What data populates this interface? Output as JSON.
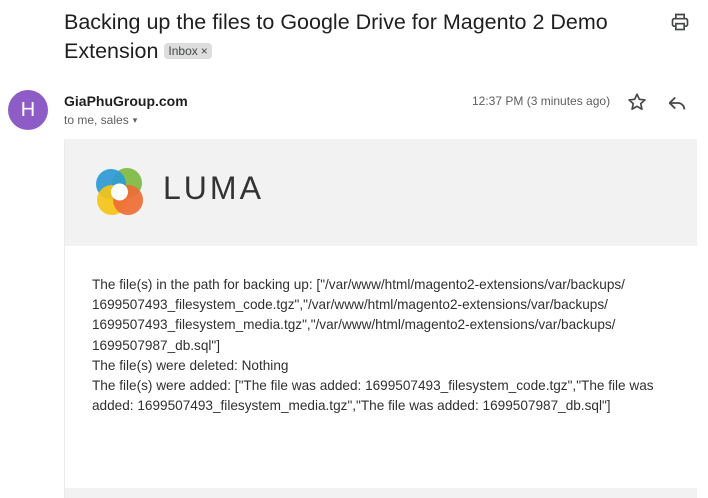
{
  "subject": "Backing up the files to Google Drive for Magento 2 Demo Extension",
  "label": {
    "text": "Inbox",
    "remove_glyph": "×"
  },
  "icons": {
    "print": "print-icon",
    "star": "star-icon",
    "reply": "reply-icon"
  },
  "sender": {
    "avatar_letter": "H",
    "avatar_color": "#8e5cc7",
    "name": "GiaPhuGroup.com",
    "recipients": "to me, sales",
    "recipients_caret": "▾",
    "time": "12:37 PM (3 minutes ago)"
  },
  "email": {
    "brand_name": "LUMA",
    "lines": [
      "The file(s) in the path for backing up: [\"/var/www/html/magento2-extensions/var/backups/ 1699507493_filesystem_code.tgz\",\"/var/www/html/magento2-extensions/var/backups/ 1699507493_filesystem_media.tgz\",\"/var/www/html/magento2-extensions/var/backups/ 1699507987_db.sql\"]",
      "The file(s) were deleted: Nothing",
      "The file(s) were added: [\"The file was added: 1699507493_filesystem_code.tgz\",\"The file was added: 1699507493_filesystem_media.tgz\",\"The file was added: 1699507987_db.sql\"]"
    ]
  },
  "colors": {
    "logo_green": "#7dbb42",
    "logo_blue": "#2e9ad6",
    "logo_yellow": "#f4c417",
    "logo_orange": "#ef6d34"
  }
}
